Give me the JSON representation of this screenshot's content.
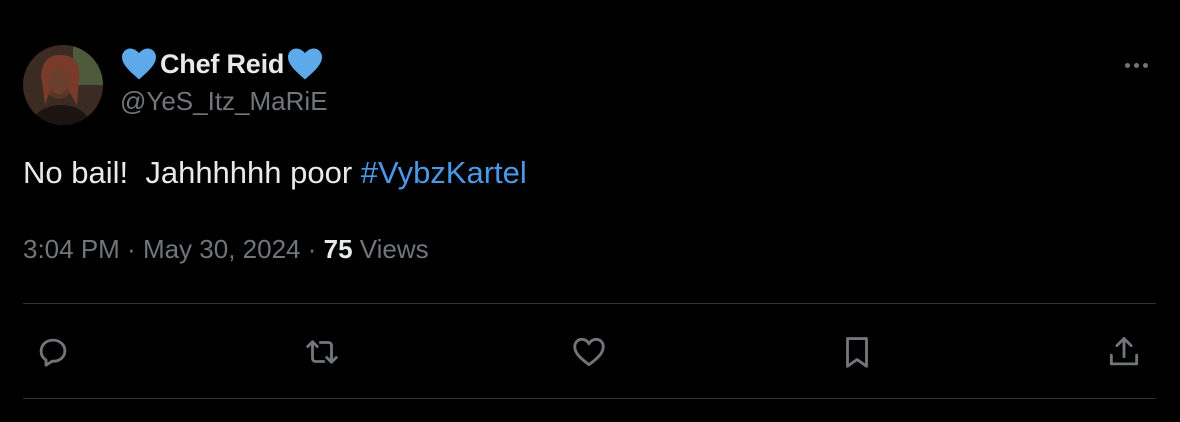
{
  "author": {
    "display_name": "Chef Reid",
    "handle": "@YeS_Itz_MaRiE",
    "name_emoji": "blue-heart-icon",
    "avatar": "profile-photo"
  },
  "tweet": {
    "text": "No bail!  Jahhhhhh poor ",
    "hashtag": "#VybzKartel"
  },
  "meta": {
    "time": "3:04 PM",
    "separator": " · ",
    "date": "May 30, 2024",
    "views_count": "75",
    "views_label": " Views"
  },
  "actions": [
    {
      "name": "reply",
      "icon": "reply-icon"
    },
    {
      "name": "retweet",
      "icon": "retweet-icon"
    },
    {
      "name": "like",
      "icon": "heart-icon"
    },
    {
      "name": "bookmark",
      "icon": "bookmark-icon"
    },
    {
      "name": "share",
      "icon": "share-icon"
    }
  ],
  "colors": {
    "background": "#000000",
    "text": "#e7e9ea",
    "secondary": "#71767b",
    "link": "#4a99e9",
    "heart_emoji": "#5da9e9",
    "divider": "#2f3336"
  }
}
